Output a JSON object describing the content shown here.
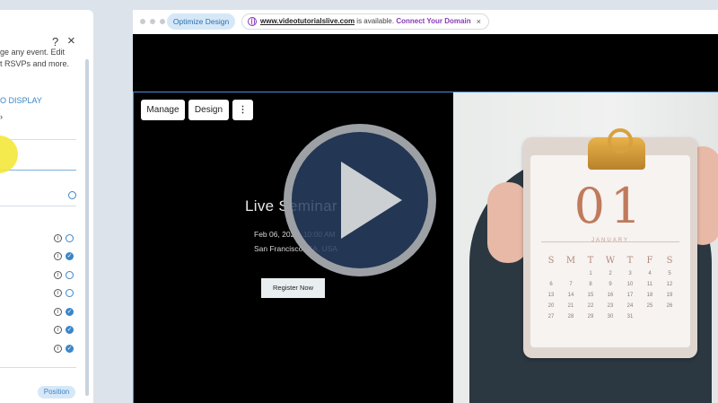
{
  "panel": {
    "help_icon": "?",
    "close_icon": "×",
    "description_lines": [
      "ge any event. Edit",
      "t RSVPs and more."
    ],
    "display_link": "O DISPLAY",
    "position_button": "Position"
  },
  "browser": {
    "optimize_button": "Optimize Design",
    "url_domain": "www.videotutorialslive.com",
    "url_available": " is available.",
    "url_connect": "Connect Your Domain",
    "url_close": "×"
  },
  "editor": {
    "manage_button": "Manage",
    "design_button": "Design",
    "more_button": "⋮"
  },
  "event": {
    "title": "Live Seminar 3",
    "date": "Feb 06, 2025, 10:00 AM",
    "location": "San Francisco, CA, USA",
    "register_button": "Register Now"
  },
  "calendar": {
    "number": "01",
    "month": "JANUARY",
    "weekdays": [
      "S",
      "M",
      "T",
      "W",
      "T",
      "F",
      "S"
    ],
    "days": [
      "",
      "",
      "1",
      "2",
      "3",
      "4",
      "5",
      "6",
      "7",
      "8",
      "9",
      "10",
      "11",
      "12",
      "13",
      "14",
      "15",
      "16",
      "17",
      "18",
      "19",
      "20",
      "21",
      "22",
      "23",
      "24",
      "25",
      "26",
      "27",
      "28",
      "29",
      "30",
      "31"
    ]
  },
  "colors": {
    "accent_blue": "#3a86c8",
    "selection_blue": "#4a8fe0",
    "connect_purple": "#8a3ab9",
    "play_fill": "#294061"
  }
}
